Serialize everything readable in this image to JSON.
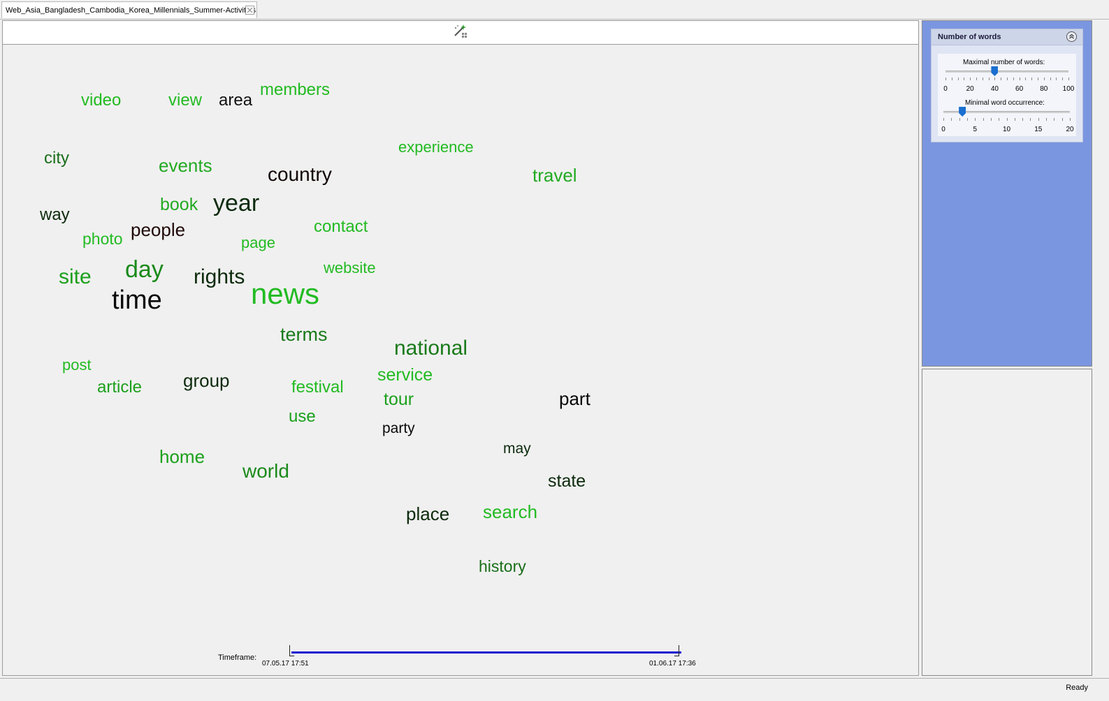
{
  "tab": {
    "title": "Web_Asia_Bangladesh_Cambodia_Korea_Millennials_Summer-Activities"
  },
  "toolbar": {
    "tool_icon": "wand-settings-icon"
  },
  "cloud": {
    "words": [
      {
        "text": "video",
        "color": "#22bb22"
      },
      {
        "text": "view",
        "color": "#22bb22"
      },
      {
        "text": "area",
        "color": "#111111"
      },
      {
        "text": "members",
        "color": "#22bb22"
      },
      {
        "text": "experience",
        "color": "#22bb22"
      },
      {
        "text": "city",
        "color": "#1a6e1a"
      },
      {
        "text": "events",
        "color": "#22aa22"
      },
      {
        "text": "country",
        "color": "#110505"
      },
      {
        "text": "travel",
        "color": "#22aa22"
      },
      {
        "text": "year",
        "color": "#0c2a0c"
      },
      {
        "text": "book",
        "color": "#22aa22"
      },
      {
        "text": "way",
        "color": "#0c2a0c"
      },
      {
        "text": "contact",
        "color": "#22bb22"
      },
      {
        "text": "people",
        "color": "#200808"
      },
      {
        "text": "photo",
        "color": "#22bb22"
      },
      {
        "text": "page",
        "color": "#22bb22"
      },
      {
        "text": "website",
        "color": "#22bb22"
      },
      {
        "text": "day",
        "color": "#1a8a1a"
      },
      {
        "text": "site",
        "color": "#1ca01c"
      },
      {
        "text": "rights",
        "color": "#0c2a0c"
      },
      {
        "text": "news",
        "color": "#22bb22"
      },
      {
        "text": "time",
        "color": "#0a0a0a"
      },
      {
        "text": "terms",
        "color": "#1a7a1a"
      },
      {
        "text": "national",
        "color": "#1a7a1a"
      },
      {
        "text": "post",
        "color": "#22bb22"
      },
      {
        "text": "service",
        "color": "#22bb22"
      },
      {
        "text": "article",
        "color": "#1ca01c"
      },
      {
        "text": "group",
        "color": "#0c2a0c"
      },
      {
        "text": "festival",
        "color": "#22bb22"
      },
      {
        "text": "tour",
        "color": "#1ca01c"
      },
      {
        "text": "part",
        "color": "#050505"
      },
      {
        "text": "use",
        "color": "#1ca01c"
      },
      {
        "text": "party",
        "color": "#0a0a0a"
      },
      {
        "text": "may",
        "color": "#0c2a0c"
      },
      {
        "text": "home",
        "color": "#1ca01c"
      },
      {
        "text": "world",
        "color": "#1a8a1a"
      },
      {
        "text": "state",
        "color": "#0c2a0c"
      },
      {
        "text": "place",
        "color": "#0c2a0c"
      },
      {
        "text": "search",
        "color": "#22bb22"
      },
      {
        "text": "history",
        "color": "#1a6e1a"
      }
    ]
  },
  "timeframe": {
    "label": "Timeframe:",
    "start": "07.05.17 17:51",
    "end": "01.06.17 17:36",
    "range": [
      0,
      1
    ]
  },
  "settings": {
    "title": "Number of words",
    "collapse_icon": "collapse-up-icon",
    "max_words": {
      "label": "Maximal number of words:",
      "value": 40,
      "min": 0,
      "max": 100,
      "ticks": [
        "0",
        "20",
        "40",
        "60",
        "80",
        "100"
      ]
    },
    "min_occurrence": {
      "label": "Minimal word occurrence:",
      "value": 3,
      "min": 0,
      "max": 20,
      "ticks": [
        "0",
        "5",
        "10",
        "15",
        "20"
      ]
    }
  },
  "status": {
    "text": "Ready"
  }
}
